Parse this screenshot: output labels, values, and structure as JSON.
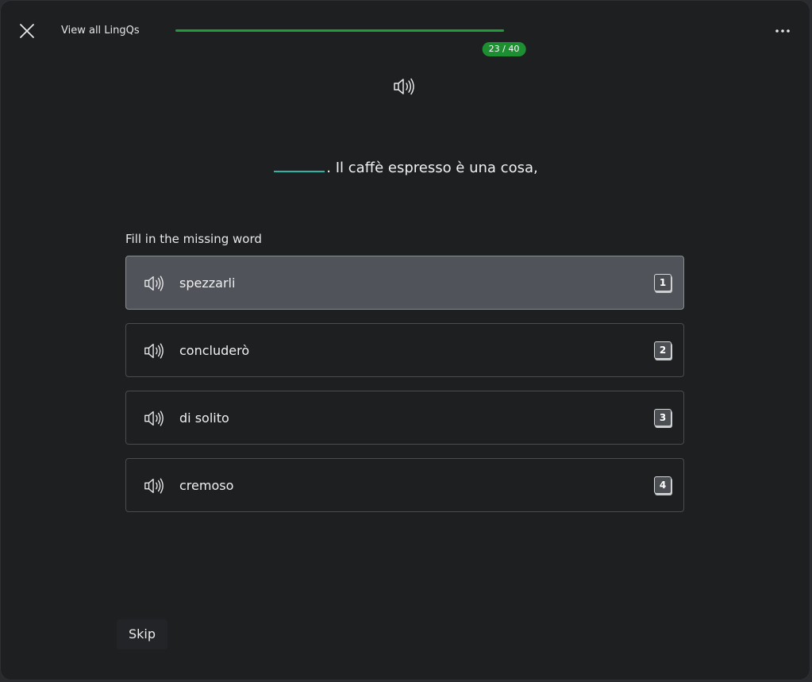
{
  "header": {
    "view_all_label": "View all LingQs",
    "progress": {
      "current": 23,
      "total": 40,
      "label": "23 / 40"
    }
  },
  "sentence": {
    "text": ". Il caffè espresso è una cosa,"
  },
  "prompt": "Fill in the missing word",
  "options": [
    {
      "word": "spezzarli",
      "key": "1",
      "selected": true
    },
    {
      "word": "concluderò",
      "key": "2",
      "selected": false
    },
    {
      "word": "di solito",
      "key": "3",
      "selected": false
    },
    {
      "word": "cremoso",
      "key": "4",
      "selected": false
    }
  ],
  "footer": {
    "skip_label": "Skip"
  },
  "colors": {
    "progress": "#1f9d3a",
    "badge": "#1e8e32",
    "blank_underline": "#2bb5a6",
    "selected_option": "#50545a"
  },
  "icons": {
    "close": "close-icon",
    "more": "more-horizontal-icon",
    "audio": "speaker-icon"
  }
}
